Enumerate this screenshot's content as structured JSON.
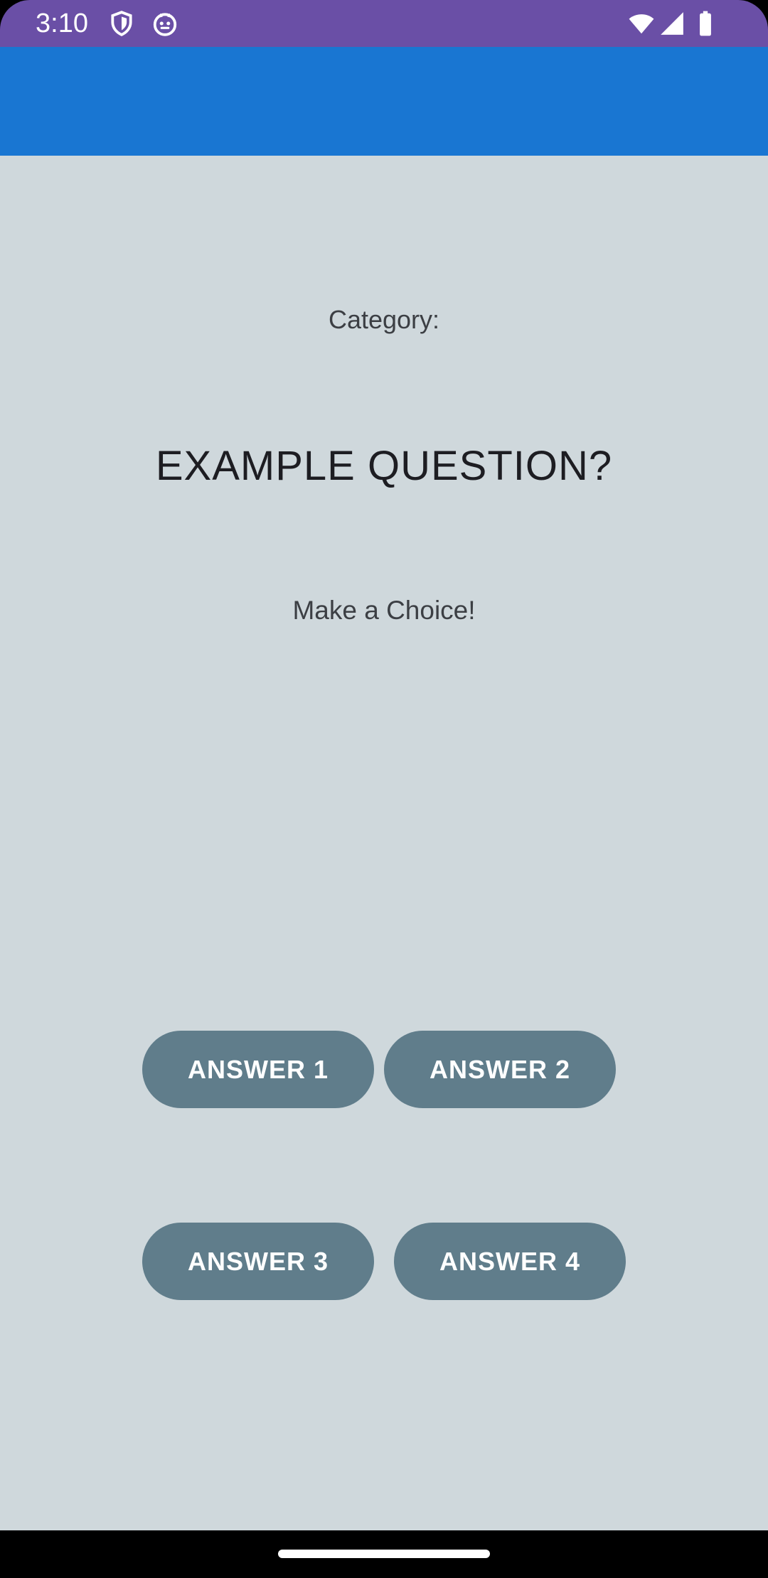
{
  "status_bar": {
    "time": "3:10",
    "icons_left": [
      "shield-icon",
      "cat-face-icon"
    ],
    "icons_right": [
      "wifi-icon",
      "cellular-signal-icon",
      "battery-icon"
    ],
    "background_color": "#6a4fa6"
  },
  "app_bar": {
    "background_color": "#1976d2"
  },
  "quiz": {
    "category_label": "Category:",
    "question": "EXAMPLE QUESTION?",
    "prompt": "Make a Choice!",
    "answers": [
      {
        "label": "ANSWER 1"
      },
      {
        "label": "ANSWER 2"
      },
      {
        "label": "ANSWER 3"
      },
      {
        "label": "ANSWER 4"
      }
    ],
    "background_color": "#cfd8dc",
    "button_color": "#607d8b"
  },
  "navigation": {
    "home_indicator": "home-indicator-bar"
  }
}
